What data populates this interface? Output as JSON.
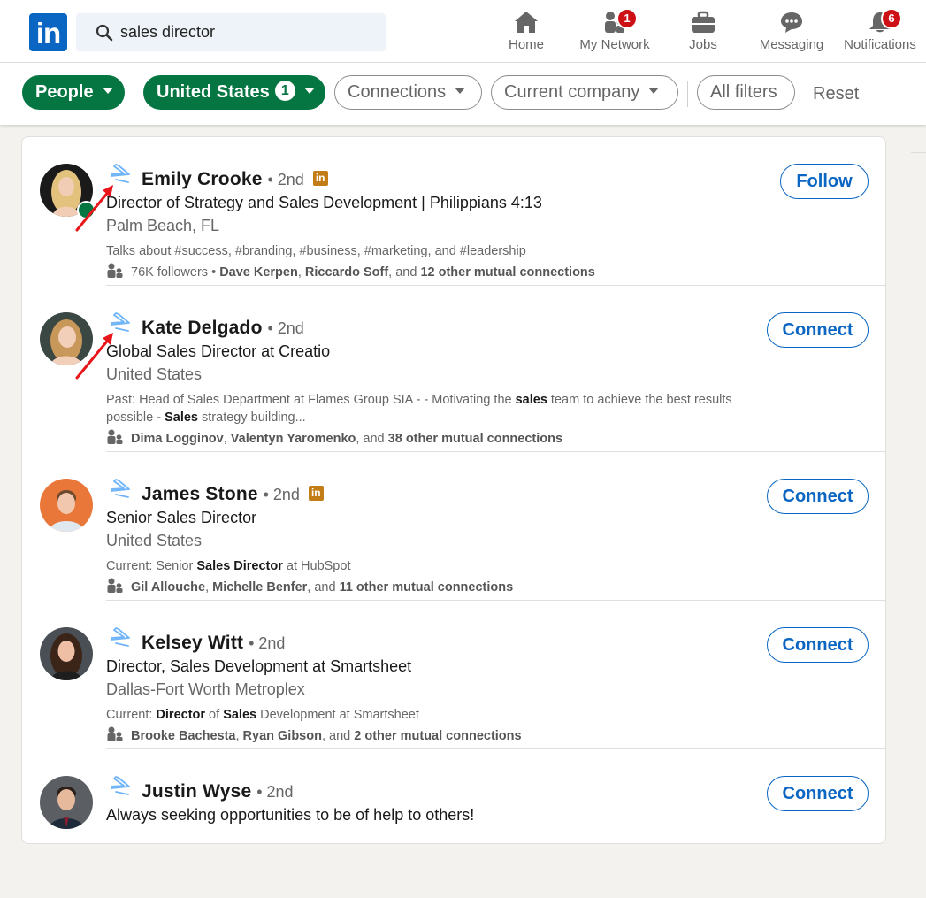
{
  "search": {
    "value": "sales director"
  },
  "nav": [
    {
      "label": "Home",
      "icon": "home-icon",
      "badge": null
    },
    {
      "label": "My Network",
      "icon": "my-network-icon",
      "badge": "1"
    },
    {
      "label": "Jobs",
      "icon": "jobs-icon",
      "badge": null
    },
    {
      "label": "Messaging",
      "icon": "messaging-icon",
      "badge": null
    },
    {
      "label": "Notifications",
      "icon": "notifications-icon",
      "badge": "6"
    }
  ],
  "filters": {
    "people": "People",
    "united_states": "United States",
    "united_states_count": "1",
    "connections": "Connections",
    "current_company": "Current company",
    "all_filters": "All filters",
    "reset": "Reset"
  },
  "colors": {
    "brand": "#0a66c2",
    "green": "#057642",
    "badge_red": "#cc1016",
    "premium_gold": "#c37d16"
  },
  "results": [
    {
      "name": "Emily Crooke",
      "degree": "• 2nd",
      "premium": true,
      "online": true,
      "headline": "Director of Strategy and Sales Development | Philippians 4:13",
      "location": "Palm Beach, FL",
      "summary_parts": [
        {
          "t": "Talks about #success, #branding, #business, #marketing, and #leadership",
          "b": false
        }
      ],
      "mutual_parts": [
        {
          "t": "76K followers • ",
          "b": false
        },
        {
          "t": "Dave Kerpen",
          "b": true
        },
        {
          "t": ", ",
          "b": false
        },
        {
          "t": "Riccardo Soff",
          "b": true
        },
        {
          "t": ", and ",
          "b": false
        },
        {
          "t": "12 other mutual connections",
          "b": true
        }
      ],
      "action": "Follow"
    },
    {
      "name": "Kate Delgado",
      "degree": "• 2nd",
      "premium": false,
      "online": false,
      "headline": "Global Sales Director at Creatio",
      "location": "United States",
      "summary_parts": [
        {
          "t": "Past: Head of Sales Department at Flames Group SIA - - Motivating the ",
          "b": false
        },
        {
          "t": "sales",
          "b": true
        },
        {
          "t": " team to achieve the best results possible - ",
          "b": false
        },
        {
          "t": "Sales",
          "b": true
        },
        {
          "t": " strategy building...",
          "b": false
        }
      ],
      "mutual_parts": [
        {
          "t": "Dima Logginov",
          "b": true
        },
        {
          "t": ", ",
          "b": false
        },
        {
          "t": "Valentyn Yaromenko",
          "b": true
        },
        {
          "t": ", and ",
          "b": false
        },
        {
          "t": "38 other mutual connections",
          "b": true
        }
      ],
      "action": "Connect"
    },
    {
      "name": "James Stone",
      "degree": "• 2nd",
      "premium": true,
      "online": false,
      "headline": "Senior Sales Director",
      "location": "United States",
      "summary_parts": [
        {
          "t": "Current: Senior ",
          "b": false
        },
        {
          "t": "Sales Director",
          "b": true
        },
        {
          "t": " at HubSpot",
          "b": false
        }
      ],
      "mutual_parts": [
        {
          "t": "Gil Allouche",
          "b": true
        },
        {
          "t": ", ",
          "b": false
        },
        {
          "t": "Michelle Benfer",
          "b": true
        },
        {
          "t": ", and ",
          "b": false
        },
        {
          "t": "11 other mutual connections",
          "b": true
        }
      ],
      "action": "Connect"
    },
    {
      "name": "Kelsey Witt",
      "degree": "• 2nd",
      "premium": false,
      "online": false,
      "headline": "Director, Sales Development at Smartsheet",
      "location": "Dallas-Fort Worth Metroplex",
      "summary_parts": [
        {
          "t": "Current: ",
          "b": false
        },
        {
          "t": "Director",
          "b": true
        },
        {
          "t": " of ",
          "b": false
        },
        {
          "t": "Sales",
          "b": true
        },
        {
          "t": " Development at Smartsheet",
          "b": false
        }
      ],
      "mutual_parts": [
        {
          "t": "Brooke Bachesta",
          "b": true
        },
        {
          "t": ", ",
          "b": false
        },
        {
          "t": "Ryan Gibson",
          "b": true
        },
        {
          "t": ", and ",
          "b": false
        },
        {
          "t": "2 other mutual connections",
          "b": true
        }
      ],
      "action": "Connect"
    },
    {
      "name": "Justin Wyse",
      "degree": "• 2nd",
      "premium": false,
      "online": false,
      "headline": "Always seeking opportunities to be of help to others!",
      "location": "",
      "summary_parts": [],
      "mutual_parts": [],
      "action": "Connect"
    }
  ]
}
